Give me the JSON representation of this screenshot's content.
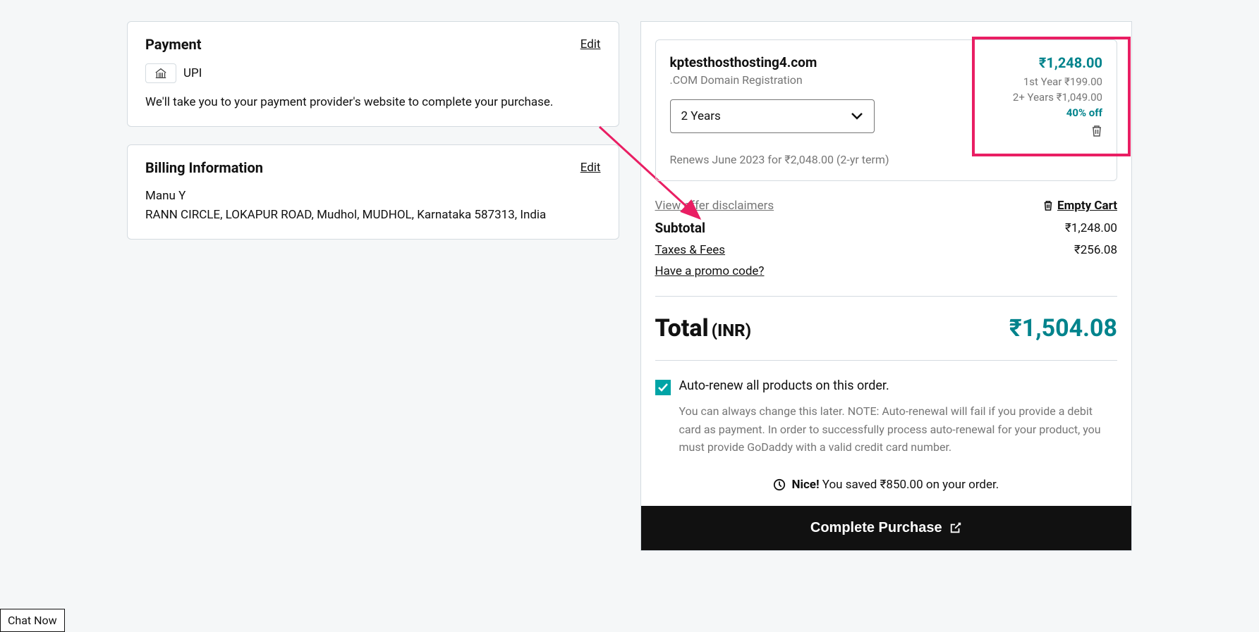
{
  "payment": {
    "title": "Payment",
    "edit": "Edit",
    "method_label": "UPI",
    "description": "We'll take you to your payment provider's website to complete your purchase."
  },
  "billing": {
    "title": "Billing Information",
    "edit": "Edit",
    "name": "Manu Y",
    "address": "RANN CIRCLE, LOKAPUR ROAD, Mudhol, MUDHOL, Karnataka 587313, India"
  },
  "product": {
    "name": "kptesthosthosting4.com",
    "subtitle": ".COM Domain Registration",
    "term_selected": "2 Years",
    "price": "₹1,248.00",
    "year1": "1st Year ₹199.00",
    "year2plus": "2+ Years ₹1,049.00",
    "discount": "40% off",
    "renews": "Renews June 2023 for ₹2,048.00 (2-yr term)"
  },
  "summary": {
    "view_disclaimers": "View offer disclaimers",
    "empty_cart": "Empty Cart",
    "subtotal_label": "Subtotal",
    "subtotal_value": "₹1,248.00",
    "taxes_label": "Taxes & Fees",
    "taxes_value": "₹256.08",
    "promo": "Have a promo code?",
    "total_label": "Total",
    "total_currency": "(INR)",
    "total_value": "₹1,504.08"
  },
  "autorenew": {
    "label": "Auto-renew all products on this order.",
    "note": "You can always change this later. NOTE: Auto-renewal will fail if you provide a debit card as payment. In order to successfully process auto-renewal for your product, you must provide GoDaddy with a valid credit card number."
  },
  "nice": {
    "bold": "Nice!",
    "text": " You saved ₹850.00 on your order."
  },
  "complete_button": "Complete Purchase",
  "chat_now": "Chat Now"
}
